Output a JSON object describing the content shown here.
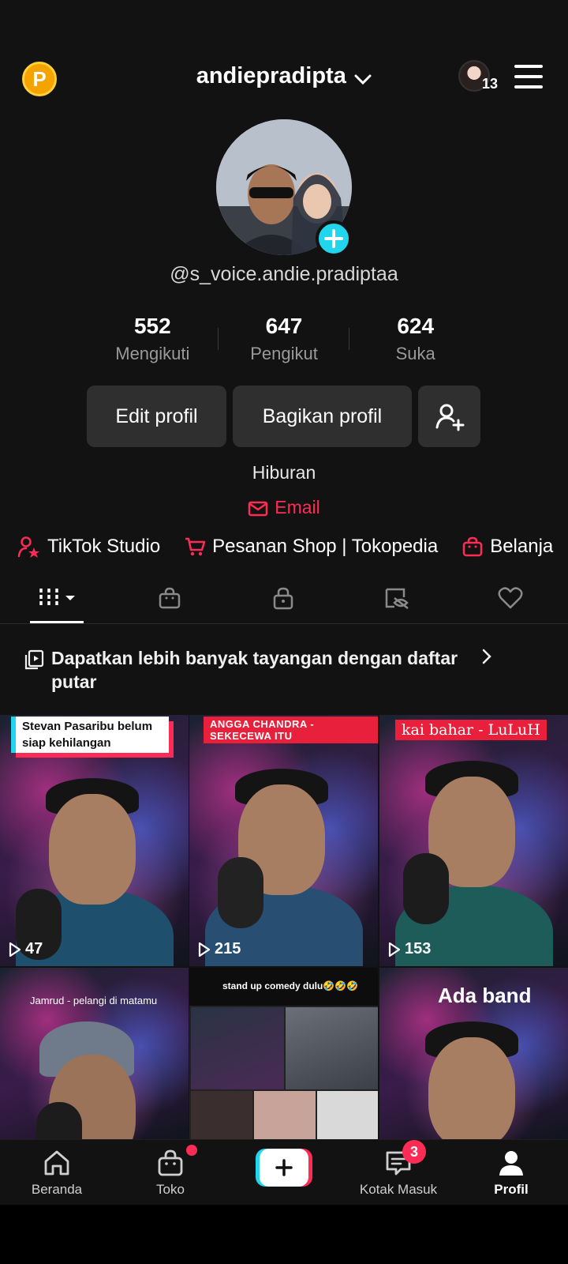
{
  "header": {
    "coin_letter": "P",
    "username": "andiepradipta",
    "notification_count": "13"
  },
  "profile": {
    "handle": "@s_voice.andie.pradiptaa",
    "stats": [
      {
        "value": "552",
        "label": "Mengikuti"
      },
      {
        "value": "647",
        "label": "Pengikut"
      },
      {
        "value": "624",
        "label": "Suka"
      }
    ],
    "buttons": {
      "edit": "Edit profil",
      "share": "Bagikan profil"
    },
    "bio": "Hiburan",
    "email": "Email",
    "links": [
      "TikTok Studio",
      "Pesanan Shop | Tokopedia",
      "Belanja"
    ]
  },
  "playlist_prompt": "Dapatkan lebih banyak tayangan dengan daftar putar",
  "videos": [
    {
      "caption": "Stevan Pasaribu belum siap kehilangan",
      "views": "47"
    },
    {
      "caption": "ANGGA CHANDRA - SEKECEWA ITU",
      "views": "215"
    },
    {
      "caption": "kai bahar - LuLuH",
      "views": "153"
    },
    {
      "caption": "Jamrud - pelangi di matamu",
      "views": ""
    },
    {
      "caption": "stand up comedy dulu🤣🤣🤣",
      "views": ""
    },
    {
      "caption": "Ada band",
      "views": ""
    }
  ],
  "bottom_nav": {
    "home": "Beranda",
    "shop": "Toko",
    "inbox": "Kotak Masuk",
    "inbox_badge": "3",
    "profile": "Profil"
  },
  "colors": {
    "accent_red": "#fe2c55",
    "accent_cyan": "#20d5ec",
    "background": "#121212"
  }
}
